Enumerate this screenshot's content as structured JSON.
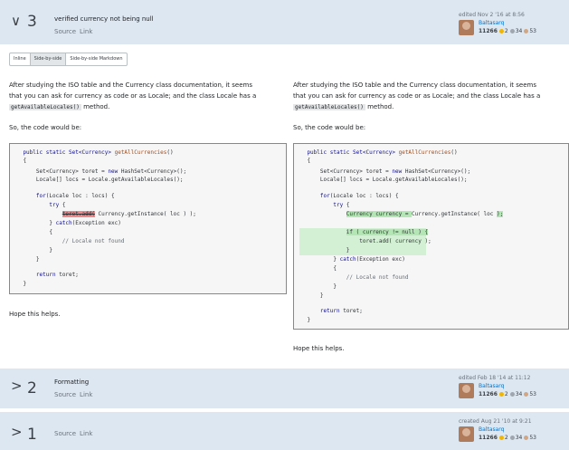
{
  "revisions": [
    {
      "number": "3",
      "comment": "verified currency not being null",
      "links": [
        "Source",
        "Link"
      ],
      "meta": "edited Nov 2 '16 at 8:56",
      "user": "Baltasarq",
      "rep": "11266",
      "gold": "2",
      "silver": "34",
      "bronze": "53"
    },
    {
      "number": "2",
      "comment": "Formatting",
      "links": [
        "Source",
        "Link"
      ],
      "meta": "edited Feb 18 '14 at 11:12",
      "user": "Baltasarq",
      "rep": "11266",
      "gold": "2",
      "silver": "34",
      "bronze": "53"
    },
    {
      "number": "1",
      "comment": "",
      "links": [
        "Source",
        "Link"
      ],
      "meta": "created Aug 21 '10 at 9:21",
      "user": "Baltasarq",
      "rep": "11266",
      "gold": "2",
      "silver": "34",
      "bronze": "53"
    }
  ],
  "tabs": [
    "Inline",
    "Side-by-side",
    "Side-by-side Markdown"
  ],
  "active_tab": "Side-by-side",
  "left": {
    "intro_a": "After studying the ISO table and the Currency class documentation, it seems",
    "intro_b": "that you can ask for currency as code or as Locale; and the class Locale has a",
    "intro_code": "getAvailableLocales()",
    "intro_end": " method.",
    "so": "So, the code would be:",
    "outro": "Hope this helps."
  },
  "right": {
    "intro_a": "After studying the ISO table and the Currency class documentation, it seems",
    "intro_b": "that you can ask for currency as code or as Locale; and the class Locale has a",
    "intro_code": "getAvailableLocales()",
    "intro_end": " method.",
    "so": "So, the code would be:",
    "outro": "Hope this helps."
  },
  "code_left": {
    "l1a": "    public static Set<Currency> ",
    "l1b": "getAllCurrencies",
    "l1c": "()",
    "l2": "    {",
    "l3a": "        Set<Currency> toret = ",
    "l3b": "new",
    "l3c": " HashSet<Currency>();",
    "l4": "        Locale[] locs = Locale.getAvailableLocales();",
    "l5": "",
    "l6a": "        ",
    "l6b": "for",
    "l6c": "(Locale loc : locs) {",
    "l7a": "            ",
    "l7b": "try",
    "l7c": " {",
    "l8a": "                ",
    "l8b": "toret.add(",
    "l8c": " Currency.getInstance( loc ) );",
    "l9a": "            } ",
    "l9b": "catch",
    "l9c": "(Exception exc)",
    "l10": "            {",
    "l11": "                // Locale not found",
    "l12": "            }",
    "l13": "        }",
    "l14": "",
    "l15a": "        ",
    "l15b": "return",
    "l15c": " toret;",
    "l16": "    }"
  },
  "code_right": {
    "l1a": "    public static Set<Currency> ",
    "l1b": "getAllCurrencies",
    "l1c": "()",
    "l2": "    {",
    "l3a": "        Set<Currency> toret = ",
    "l3b": "new",
    "l3c": " HashSet<Currency>();",
    "l4": "        Locale[] locs = Locale.getAvailableLocales();",
    "l5": "",
    "l6a": "        ",
    "l6b": "for",
    "l6c": "(Locale loc : locs) {",
    "l7a": "            ",
    "l7b": "try",
    "l7c": " {",
    "l8a": "                ",
    "l8b": "Currency currency = ",
    "l8c": "Currency.getInstance( loc ",
    "l8d": ");",
    "l9": "",
    "l10a": "                ",
    "l10b": "if ( currency != null ) {",
    "l11": "                    toret.add( currency );",
    "l12": "                }",
    "l13a": "            } ",
    "l13b": "catch",
    "l13c": "(Exception exc)",
    "l14": "            {",
    "l15": "                // Locale not found",
    "l16": "            }",
    "l17": "        }",
    "l18": "",
    "l19a": "        ",
    "l19b": "return",
    "l19c": " toret;",
    "l20": "    }"
  },
  "colors": {
    "header_bg": "#dde7f2",
    "gold": "#f1b600",
    "silver": "#9fa6ad",
    "bronze": "#d1a684",
    "user": "#0074cc"
  }
}
